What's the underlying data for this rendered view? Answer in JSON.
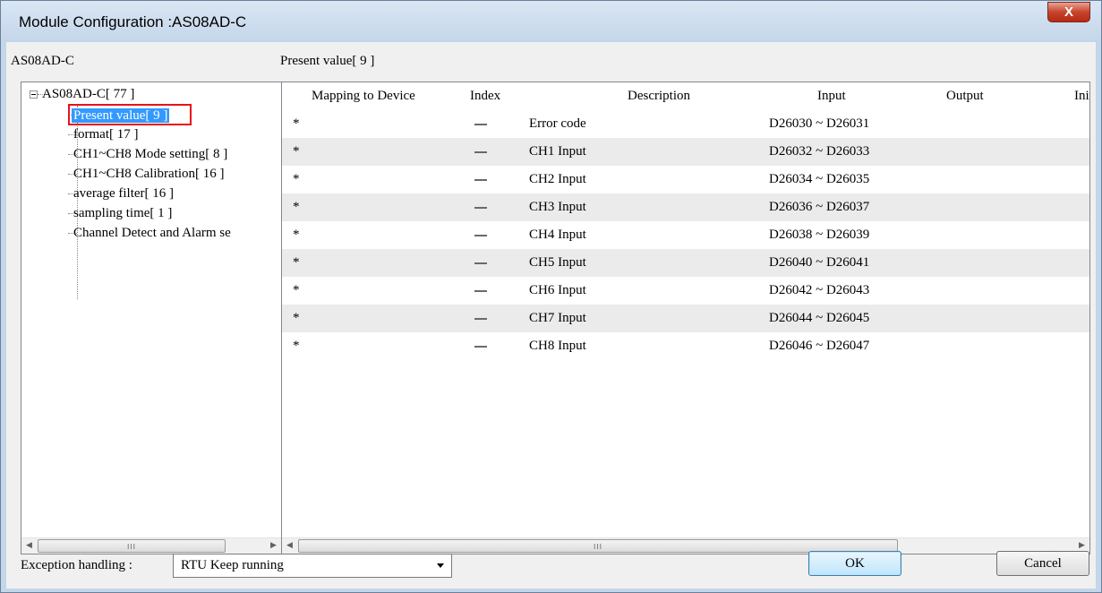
{
  "window": {
    "title": "Module Configuration :AS08AD-C",
    "close_label": "X"
  },
  "left_panel": {
    "header": "AS08AD-C",
    "tree": {
      "root": "AS08AD-C[ 77 ]",
      "children": [
        "Present value[ 9 ]",
        "format[ 17 ]",
        "CH1~CH8 Mode setting[ 8 ]",
        "CH1~CH8 Calibration[ 16 ]",
        "average filter[ 16 ]",
        "sampling time[ 1 ]",
        "Channel Detect and Alarm se"
      ],
      "selected_index": 0
    },
    "scroll_grip": "III"
  },
  "right_panel": {
    "header": "Present value[ 9 ]",
    "columns": [
      "Mapping to Device",
      "Index",
      "Description",
      "Input",
      "Output",
      "Init"
    ],
    "rows": [
      {
        "mapping": "*",
        "index": "—",
        "description": "Error code",
        "input": "D26030 ~ D26031",
        "output": ""
      },
      {
        "mapping": "*",
        "index": "—",
        "description": "CH1 Input",
        "input": "D26032 ~ D26033",
        "output": ""
      },
      {
        "mapping": "*",
        "index": "—",
        "description": "CH2 Input",
        "input": "D26034 ~ D26035",
        "output": ""
      },
      {
        "mapping": "*",
        "index": "—",
        "description": "CH3 Input",
        "input": "D26036 ~ D26037",
        "output": ""
      },
      {
        "mapping": "*",
        "index": "—",
        "description": "CH4 Input",
        "input": "D26038 ~ D26039",
        "output": ""
      },
      {
        "mapping": "*",
        "index": "—",
        "description": "CH5 Input",
        "input": "D26040 ~ D26041",
        "output": ""
      },
      {
        "mapping": "*",
        "index": "—",
        "description": "CH6 Input",
        "input": "D26042 ~ D26043",
        "output": ""
      },
      {
        "mapping": "*",
        "index": "—",
        "description": "CH7 Input",
        "input": "D26044 ~ D26045",
        "output": ""
      },
      {
        "mapping": "*",
        "index": "—",
        "description": "CH8 Input",
        "input": "D26046 ~ D26047",
        "output": ""
      }
    ],
    "scroll_grip": "III"
  },
  "footer": {
    "exception_label": "Exception handling :",
    "exception_value": "RTU Keep running",
    "ok_label": "OK",
    "cancel_label": "Cancel"
  },
  "colors": {
    "selection": "#3399ff",
    "highlight_box": "#e8121c",
    "row_alt": "#ebebeb"
  }
}
